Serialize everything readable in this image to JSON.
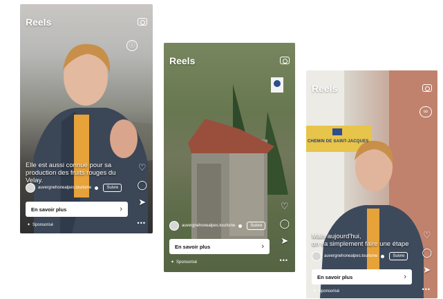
{
  "screens": [
    {
      "header_title": "Reels",
      "caption": [
        "Elle est aussi connue pour sa",
        "production des fruits rouges du",
        "Velay."
      ],
      "account_name": "auvergnehonealpes.tourisme",
      "follow_label": "Suivre",
      "cta_label": "En savoir plus",
      "sponsored_label": "Sponsorisé"
    },
    {
      "header_title": "Reels",
      "caption": [],
      "account_name": "auvergnehonealpes.tourisme",
      "follow_label": "Suivre",
      "cta_label": "En savoir plus",
      "sponsored_label": "Sponsorisé"
    },
    {
      "header_title": "Reels",
      "caption": [
        "Mais aujourd'hui,",
        "on va simplement faire une étape"
      ],
      "account_name": "auvergnehonealpes.tourisme",
      "follow_label": "Suivre",
      "cta_label": "En savoir plus",
      "sponsored_label": "Sponsorisé",
      "sign_text": "CHEMIN DE SAINT-JACQUES"
    }
  ],
  "icons": {
    "camera": "camera-icon",
    "like": "heart-icon",
    "comment": "comment-icon",
    "share": "send-icon",
    "more": "more-icon"
  }
}
